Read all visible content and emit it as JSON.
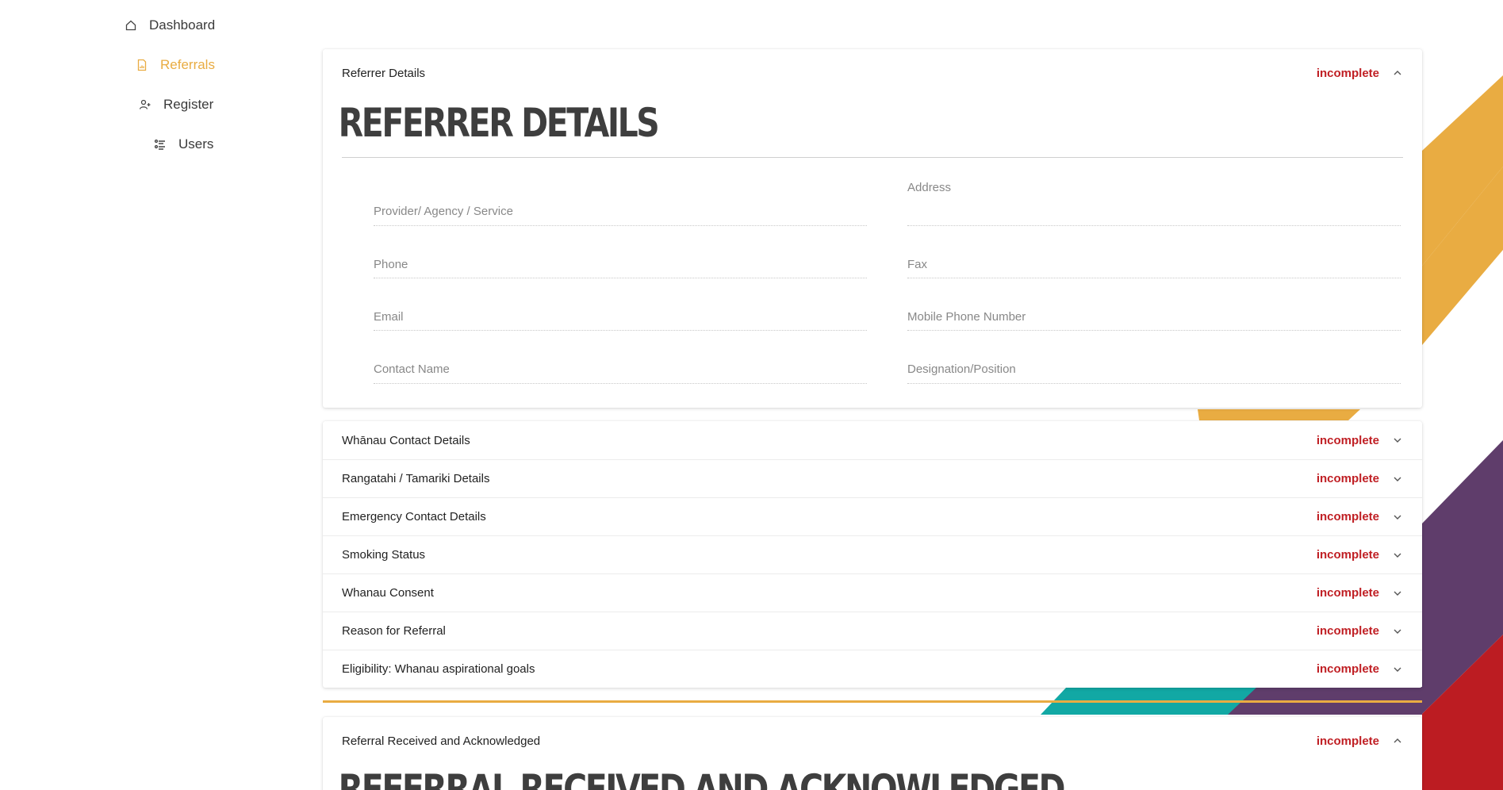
{
  "colors": {
    "accent": "#e9ac42",
    "status_incomplete": "#c01f24",
    "deco_purple": "#5f3d6b",
    "deco_teal": "#12a8a4",
    "deco_red": "#bc1c22"
  },
  "sidebar": {
    "items": [
      {
        "label": "Dashboard",
        "icon": "home-icon",
        "active": false
      },
      {
        "label": "Referrals",
        "icon": "document-icon",
        "active": true
      },
      {
        "label": "Register",
        "icon": "add-user-icon",
        "active": false
      },
      {
        "label": "Users",
        "icon": "users-list-icon",
        "active": false
      }
    ]
  },
  "referrer_section": {
    "header": "Referrer Details",
    "status": "incomplete",
    "big_title": "REFERRER DETAILS",
    "fields": {
      "provider": "Provider/ Agency / Service",
      "address": "Address",
      "phone": "Phone",
      "fax": "Fax",
      "email": "Email",
      "mobile": "Mobile Phone Number",
      "contact_name": "Contact Name",
      "designation": "Designation/Position"
    }
  },
  "sections": [
    {
      "title": "Whānau Contact Details",
      "status": "incomplete"
    },
    {
      "title": "Rangatahi / Tamariki Details",
      "status": "incomplete"
    },
    {
      "title": "Emergency Contact Details",
      "status": "incomplete"
    },
    {
      "title": "Smoking Status",
      "status": "incomplete"
    },
    {
      "title": "Whanau Consent",
      "status": "incomplete"
    },
    {
      "title": "Reason for Referral",
      "status": "incomplete"
    },
    {
      "title": "Eligibility: Whanau aspirational goals",
      "status": "incomplete"
    }
  ],
  "acknowledged_section": {
    "header": "Referral Received and Acknowledged",
    "status": "incomplete",
    "big_title": "REFERRAL RECEIVED AND ACKNOWLEDGED"
  }
}
